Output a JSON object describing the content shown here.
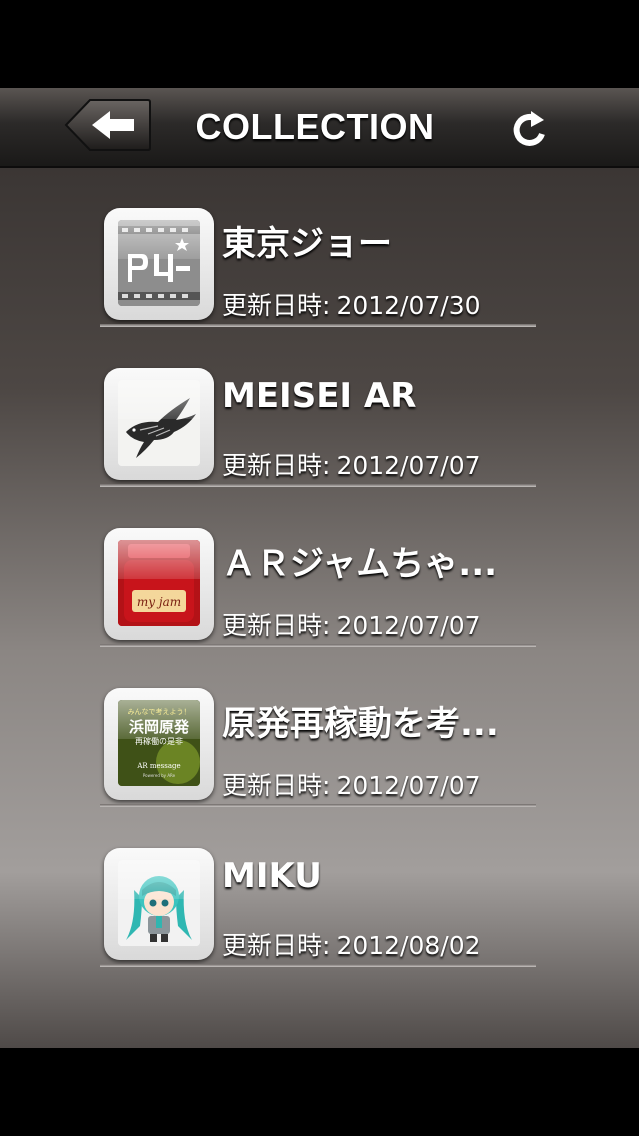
{
  "nav": {
    "title": "COLLECTION",
    "back_icon": "back-arrow-icon",
    "refresh_icon": "refresh-icon"
  },
  "date_label": "更新日時:",
  "items": [
    {
      "title": "東京ジョー",
      "date": "2012/07/30",
      "thumb": "film-strip-logo"
    },
    {
      "title": "MEISEI AR",
      "date": "2012/07/07",
      "thumb": "bird-sketch"
    },
    {
      "title": "ＡＲジャムちゃ...",
      "date": "2012/07/07",
      "thumb": "jam-jar",
      "thumb_text": "my jam"
    },
    {
      "title": "原発再稼動を考...",
      "date": "2012/07/07",
      "thumb": "hamaoka-poster",
      "thumb_text": [
        "みんなで考えよう！",
        "浜岡原発",
        "再稼働の是非",
        "AR message",
        "Powered by ARe"
      ]
    },
    {
      "title": "MIKU",
      "date": "2012/08/02",
      "thumb": "miku-figure"
    }
  ]
}
